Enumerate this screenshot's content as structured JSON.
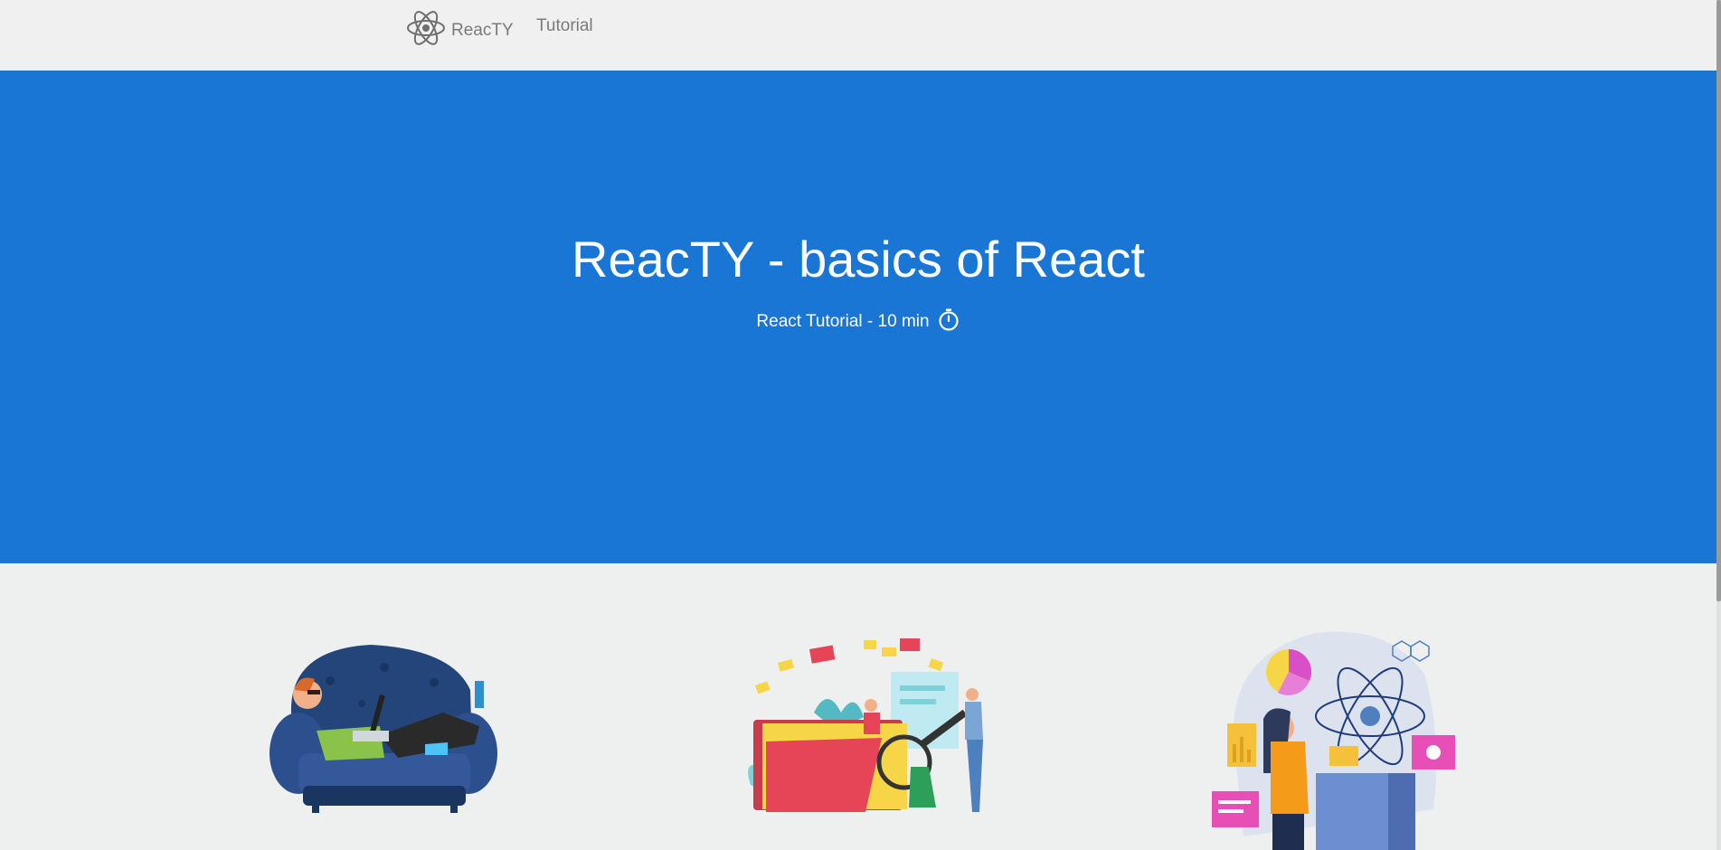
{
  "navbar": {
    "brand": "ReacTY",
    "links": [
      "Tutorial"
    ],
    "logo_icon": "react-atom-icon"
  },
  "hero": {
    "title": "ReacTY - basics of React",
    "subtitle": "React Tutorial - 10 min",
    "subtitle_icon": "stopwatch-icon",
    "background": "#1a76d4"
  },
  "features": {
    "illustrations": [
      "person-on-couch-illustration",
      "folders-search-illustration",
      "science-dashboard-illustration"
    ]
  },
  "colors": {
    "page_background": "#eef0ef",
    "nav_text": "#7a7a7a",
    "accent": "#1a76d4"
  }
}
